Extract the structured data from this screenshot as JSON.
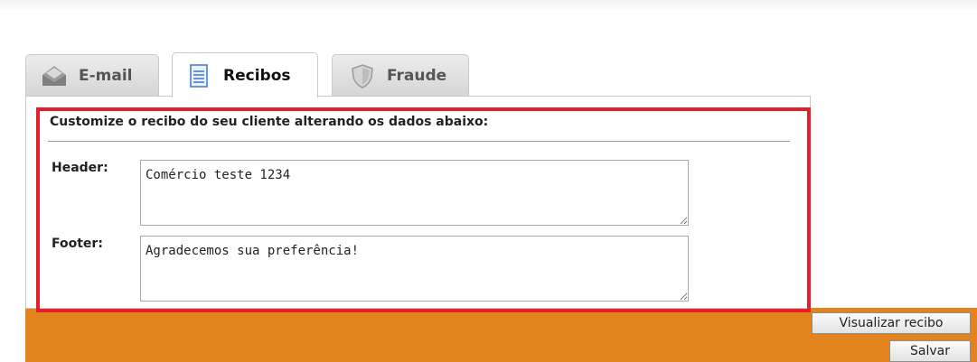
{
  "tabs": [
    {
      "label": "E-mail",
      "icon": "email-icon"
    },
    {
      "label": "Recibos",
      "icon": "receipt-icon",
      "active": true
    },
    {
      "label": "Fraude",
      "icon": "shield-icon"
    }
  ],
  "panel": {
    "heading": "Customize o recibo do seu cliente alterando os dados abaixo:",
    "header_label": "Header:",
    "header_value": "Comércio teste 1234",
    "footer_label": "Footer:",
    "footer_value": "Agradecemos sua preferência!"
  },
  "buttons": {
    "preview": "Visualizar recibo",
    "save": "Salvar"
  },
  "colors": {
    "highlight": "#e41f2c",
    "footer_bar": "#e2831e"
  }
}
